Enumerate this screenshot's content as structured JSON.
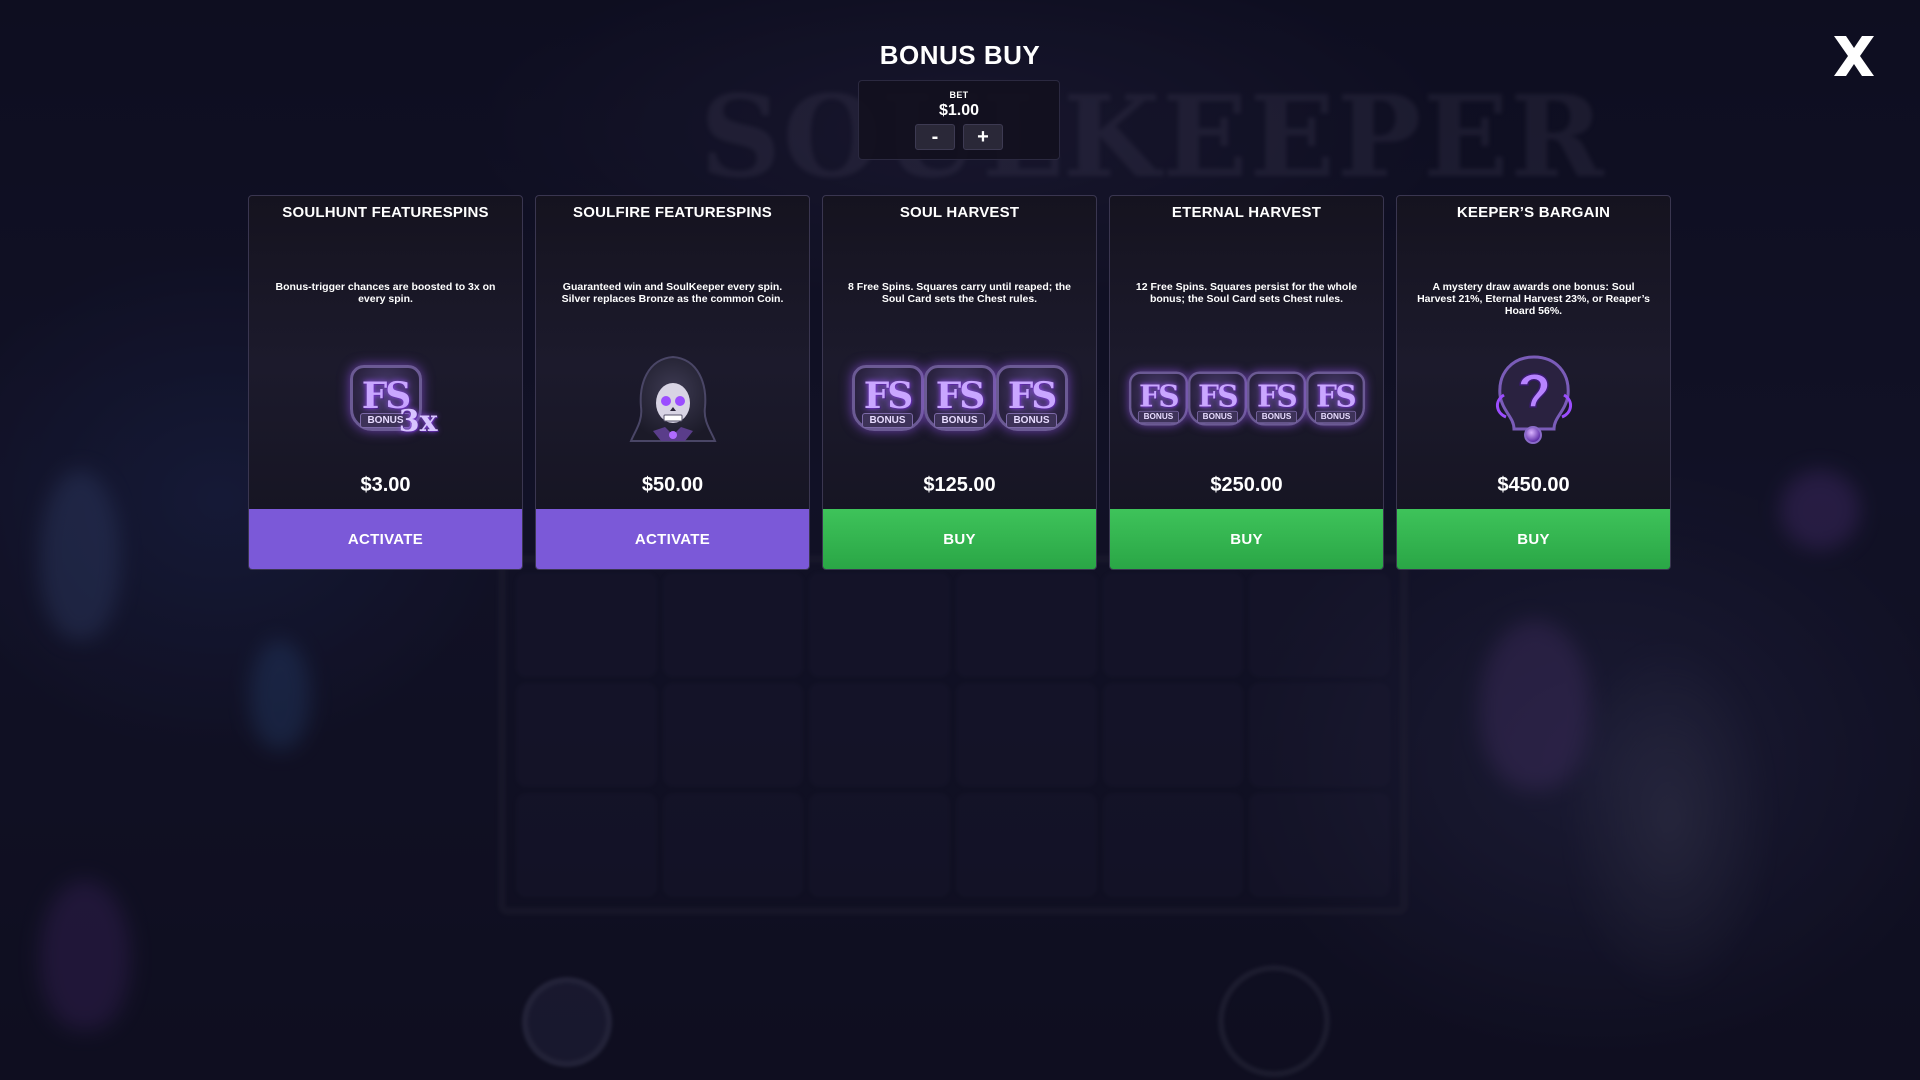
{
  "modal": {
    "title": "BONUS BUY"
  },
  "bet": {
    "label": "BET",
    "value": "$1.00",
    "decrease_label": "-",
    "increase_label": "+"
  },
  "close_icon": "close-x-icon",
  "cards": [
    {
      "title": "SOULHUNT FEATURESPINS",
      "description": "Bonus-trigger chances are boosted to 3x on every spin.",
      "icon": "fs-bonus-3x-icon",
      "fs_text": "FS",
      "ribbon": "BONUS",
      "multiplier": "3x",
      "price": "$3.00",
      "button_label": "ACTIVATE",
      "button_type": "activate"
    },
    {
      "title": "SOULFIRE FEATURESPINS",
      "description": "Guaranteed win and SoulKeeper every spin. Silver replaces Bronze as the common Coin.",
      "icon": "hooded-skull-icon",
      "price": "$50.00",
      "button_label": "ACTIVATE",
      "button_type": "activate"
    },
    {
      "title": "SOUL HARVEST",
      "description": "8 Free Spins. Squares carry until reaped; the Soul Card sets the Chest rules.",
      "icon": "fs-bonus-triple-icon",
      "fs_text": "FS",
      "ribbon": "BONUS",
      "price": "$125.00",
      "button_label": "BUY",
      "button_type": "buy"
    },
    {
      "title": "ETERNAL HARVEST",
      "description": "12 Free Spins. Squares persist for the whole bonus; the Soul Card sets Chest rules.",
      "icon": "fs-bonus-quad-icon",
      "fs_text": "FS",
      "ribbon": "BONUS",
      "price": "$250.00",
      "button_label": "BUY",
      "button_type": "buy"
    },
    {
      "title": "KEEPER’S BARGAIN",
      "description": "A mystery draw awards one bonus: Soul Harvest 21%, Eternal Harvest 23%, or Reaper’s Hoard 56%.",
      "icon": "mystery-question-icon",
      "price": "$450.00",
      "button_label": "BUY",
      "button_type": "buy"
    }
  ],
  "colors": {
    "activate": "#7b59d8",
    "buy": "#34b651",
    "card_border": "#3a3650",
    "glow": "#9b4dff"
  }
}
